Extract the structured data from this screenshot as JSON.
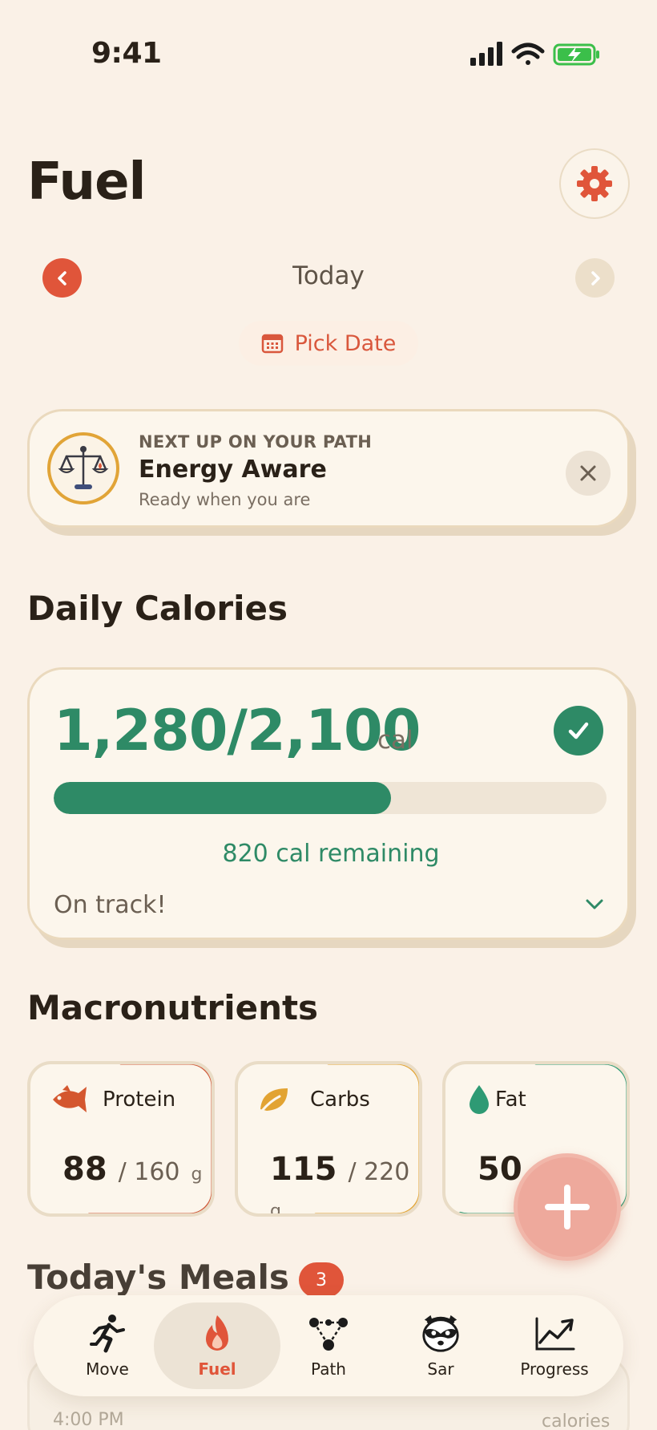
{
  "status_bar": {
    "time": "9:41"
  },
  "header": {
    "title": "Fuel"
  },
  "date_nav": {
    "label": "Today",
    "pick_date": "Pick Date"
  },
  "path_card": {
    "eyebrow": "NEXT UP ON YOUR PATH",
    "title": "Energy Aware",
    "subtitle": "Ready when you are"
  },
  "calories": {
    "section_title": "Daily Calories",
    "value": "1,280/2,100",
    "unit": "cal",
    "consumed": 1280,
    "goal": 2100,
    "progress_fraction": 0.61,
    "remaining": "820 cal remaining",
    "status": "On track!"
  },
  "macros": {
    "section_title": "Macronutrients",
    "items": [
      {
        "label": "Protein",
        "value": "88",
        "goal": "/ 160",
        "unit": "g",
        "color": "#cf5a3a",
        "progress_fraction": 0.55
      },
      {
        "label": "Carbs",
        "value": "115",
        "goal": "/ 220",
        "unit": "g",
        "color": "#e2a332",
        "progress_fraction": 0.52
      },
      {
        "label": "Fat",
        "value": "50",
        "goal": "",
        "unit": "",
        "color": "#2e9a74",
        "progress_fraction": 0.62
      }
    ]
  },
  "meals": {
    "section_title": "Today's Meals",
    "count": "3",
    "peek_time": "4:00 PM",
    "peek_unit": "calories"
  },
  "tabbar": {
    "items": [
      {
        "label": "Move",
        "icon": "runner-icon"
      },
      {
        "label": "Fuel",
        "icon": "flame-icon",
        "active": true
      },
      {
        "label": "Path",
        "icon": "path-nodes-icon"
      },
      {
        "label": "Sar",
        "icon": "raccoon-icon"
      },
      {
        "label": "Progress",
        "icon": "trend-chart-icon"
      }
    ]
  },
  "colors": {
    "background": "#faf1e7",
    "accent": "#e0553a",
    "success": "#2e8a66",
    "card": "#fcf6ec"
  }
}
